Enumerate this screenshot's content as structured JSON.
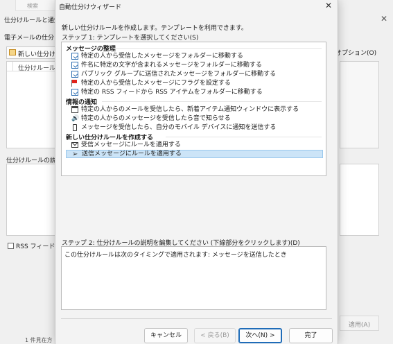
{
  "background_dialog": {
    "search_tab": "検索",
    "title": "仕分けルールと通知",
    "close_glyph": "✕",
    "email_rules_label": "電子メールの仕分け",
    "new_rule_button": "新しい仕分け",
    "options_button": "オプション(O)",
    "table_header": "仕分けルール",
    "description_label": "仕分けルールの説明",
    "rss_checkbox": "RSS フィードか",
    "apply_button": "適用(A)",
    "bottom_text": "1 件見在方"
  },
  "wizard": {
    "title": "自動仕分けウィザード",
    "close_glyph": "✕",
    "intro": "新しい仕分けルールを作成します。テンプレートを利用できます。",
    "step1_label": "ステップ 1: テンプレートを選択してください(S)",
    "groups": [
      {
        "label": "メッセージの整理",
        "items": [
          {
            "label": "特定の人から受信したメッセージをフォルダーに移動する",
            "icon": "move-to-folder-icon"
          },
          {
            "label": "件名に特定の文字が含まれるメッセージをフォルダーに移動する",
            "icon": "move-to-folder-icon"
          },
          {
            "label": "パブリック グループに送信されたメッセージをフォルダーに移動する",
            "icon": "move-to-folder-icon"
          },
          {
            "label": "特定の人から受信したメッセージにフラグを設定する",
            "icon": "flag-icon"
          },
          {
            "label": "特定の RSS フィードから RSS アイテムをフォルダーに移動する",
            "icon": "move-to-folder-icon"
          }
        ]
      },
      {
        "label": "情報の通知",
        "items": [
          {
            "label": "特定の人からのメールを受信したら、新着アイテム通知ウィンドウに表示する",
            "icon": "alert-window-icon"
          },
          {
            "label": "特定の人からのメッセージを受信したら音で知らせる",
            "icon": "sound-icon"
          },
          {
            "label": "メッセージを受信したら、自分のモバイル デバイスに通知を送信する",
            "icon": "mobile-device-icon"
          }
        ]
      },
      {
        "label": "新しい仕分けルールを作成する",
        "items": [
          {
            "label": "受信メッセージにルールを適用する",
            "icon": "envelope-icon"
          },
          {
            "label": "送信メッセージにルールを適用する",
            "icon": "send-icon",
            "selected": true
          }
        ]
      }
    ],
    "step2_label": "ステップ 2: 仕分けルールの説明を編集してください (下線部分をクリックします)(D)",
    "description_text": "この仕分けルールは次のタイミングで適用されます: メッセージを送信したとき",
    "buttons": {
      "cancel": "キャンセル",
      "back": "< 戻る(B)",
      "next": "次へ(N) >",
      "finish": "完了"
    }
  }
}
